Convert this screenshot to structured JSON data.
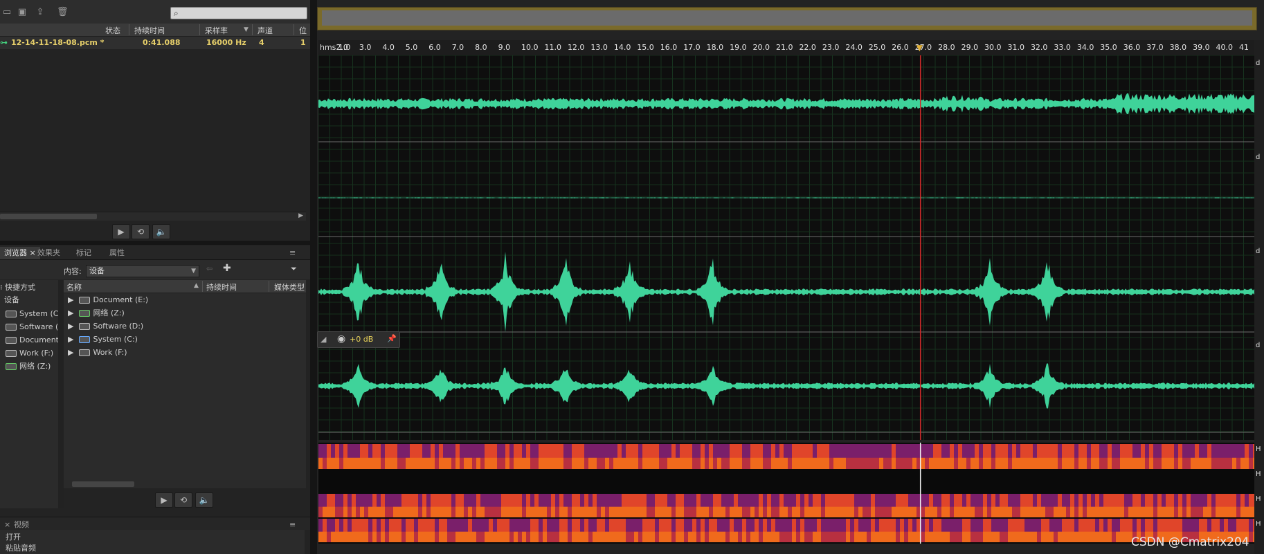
{
  "files_panel": {
    "columns": [
      "状态",
      "持续时间",
      "采样率",
      "声道",
      "位"
    ],
    "file": {
      "name": "12-14-11-18-08.pcm *",
      "duration": "0:41.088",
      "sample_rate": "16000 Hz",
      "channels": "4",
      "bits": "1"
    }
  },
  "browser": {
    "tabs": [
      "浏览器",
      "效果夹",
      "标记",
      "属性"
    ],
    "content_label": "内容:",
    "content_value": "设备",
    "left_tree": [
      "快捷方式",
      "设备",
      "System (C:",
      "Software (I",
      "Document",
      "Work (F:)",
      "网络 (Z:)"
    ],
    "table_headers": [
      "名称",
      "持续时间",
      "媒体类型"
    ],
    "items": [
      "Document (E:)",
      "网络 (Z:)",
      "Software (D:)",
      "System (C:)",
      "Work (F:)"
    ]
  },
  "bottom": {
    "tabs": [
      "视频"
    ],
    "history": [
      "打开",
      "粘贴音频"
    ]
  },
  "editor": {
    "ruler_labels": [
      "hms 1.0",
      "2.0",
      "3.0",
      "4.0",
      "5.0",
      "6.0",
      "7.0",
      "8.0",
      "9.0",
      "10.0",
      "11.0",
      "12.0",
      "13.0",
      "14.0",
      "15.0",
      "16.0",
      "17.0",
      "18.0",
      "19.0",
      "20.0",
      "21.0",
      "22.0",
      "23.0",
      "24.0",
      "25.0",
      "26.0",
      "27.0",
      "28.0",
      "29.0",
      "30.0",
      "31.0",
      "32.0",
      "33.0",
      "34.0",
      "35.0",
      "36.0",
      "37.0",
      "38.0",
      "39.0",
      "40.0",
      "41"
    ],
    "volume": "+0 dB",
    "playhead_seconds": 27.0,
    "waveform_color": "#3fd39a",
    "playhead_color": "#d12a2a"
  },
  "watermark": "CSDN @Cmatrix204"
}
